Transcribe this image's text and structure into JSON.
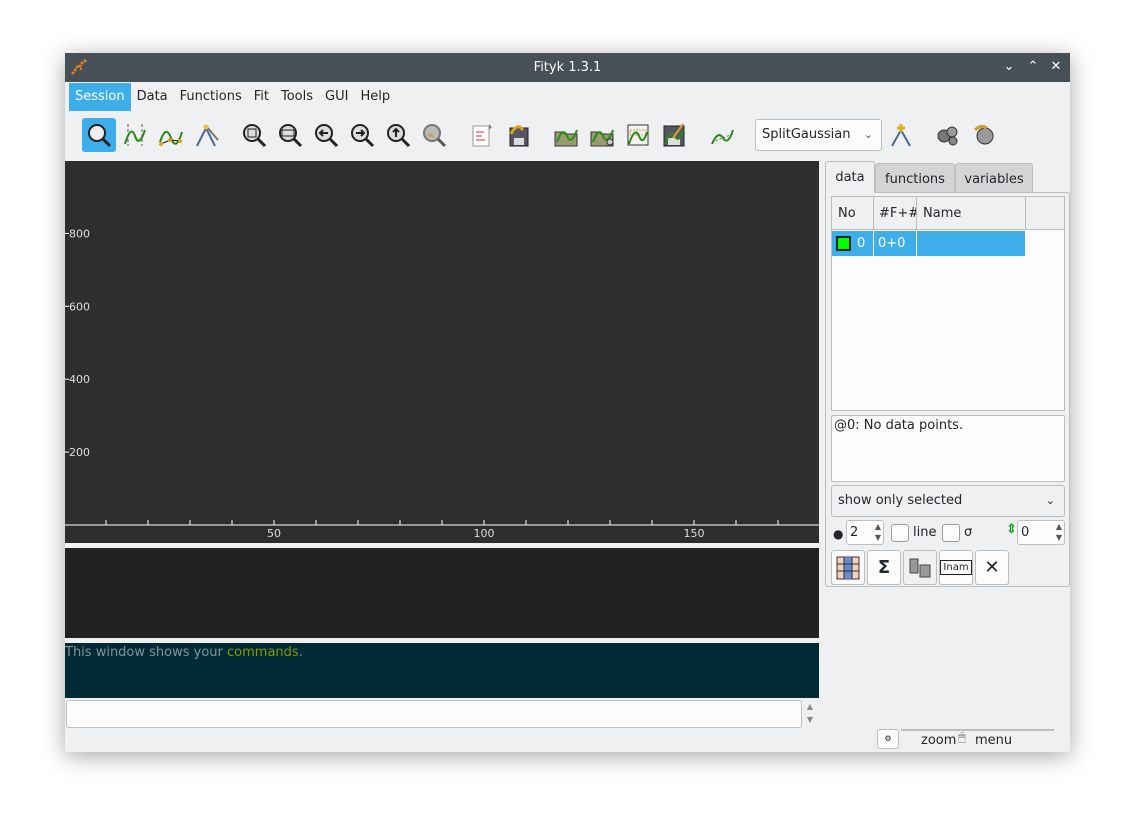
{
  "window": {
    "title": "Fityk 1.3.1"
  },
  "menu": [
    "Session",
    "Data",
    "Functions",
    "Fit",
    "Tools",
    "GUI",
    "Help"
  ],
  "toolbar": {
    "icons": [
      "zoom-mode-icon",
      "range-mode-icon",
      "baseline-mode-icon",
      "add-peak-mode-icon",
      "zoom-all-icon",
      "zoom-vertically-icon",
      "scroll-left-icon",
      "scroll-right-icon",
      "zoom-out-icon",
      "zoom-previous-icon",
      "new-script-icon",
      "run-script-icon",
      "load-data-icon",
      "load-data-advanced-icon",
      "export-data-icon",
      "save-session-icon",
      "data-transform-icon",
      "add-peak-icon",
      "start-fit-icon",
      "run-fit-icon"
    ],
    "function_type": "SplitGaussian"
  },
  "plot": {
    "background": "#2e2e2e",
    "y_ticks": [
      "800",
      "600",
      "400",
      "200"
    ],
    "x_ticks": [
      "50",
      "100",
      "150"
    ]
  },
  "output": {
    "text_prefix": "This window shows your ",
    "text_highlight": "commands",
    "text_suffix": "."
  },
  "command_input": {
    "value": ""
  },
  "right_panel": {
    "tabs": [
      "data",
      "functions",
      "variables"
    ],
    "active_tab": "data",
    "table": {
      "headers": [
        "No",
        "#F+#Z",
        "Name"
      ],
      "rows": [
        {
          "no": "0",
          "fz": "0+0",
          "name": "",
          "color": "#00ff00"
        }
      ]
    },
    "info": "@0: No data points.",
    "filter": "show only selected",
    "point_size": "2",
    "line_label": "line",
    "sigma_label": "σ",
    "shift": "0",
    "buttons": [
      "edit-data-icon",
      "sum-icon",
      "merge-icon",
      "rename-icon",
      "delete-icon"
    ],
    "button_glyphs": {
      "sum": "Σ",
      "rename": "Inam",
      "delete": "✕"
    }
  },
  "status": {
    "left": "zoom",
    "right": "menu"
  }
}
